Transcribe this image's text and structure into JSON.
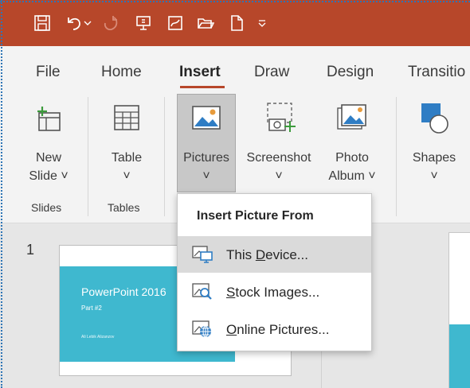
{
  "quick_access": {
    "icons": [
      "save-icon",
      "undo-icon",
      "undo-dropdown-icon",
      "redo-icon",
      "presenter-icon",
      "ink-icon",
      "open-folder-icon",
      "new-file-icon",
      "customize-qat-icon"
    ]
  },
  "tabs": [
    {
      "label": "File"
    },
    {
      "label": "Home"
    },
    {
      "label": "Insert"
    },
    {
      "label": "Draw"
    },
    {
      "label": "Design"
    },
    {
      "label": "Transitio"
    }
  ],
  "active_tab": "Insert",
  "ribbon": {
    "new_slide": {
      "line1": "New",
      "line2": "Slide ˅"
    },
    "table": {
      "line1": "Table",
      "line2": "˅"
    },
    "pictures": {
      "line1": "Pictures",
      "line2": "˅"
    },
    "screenshot": {
      "line1": "Screenshot",
      "line2": "˅"
    },
    "photo_album": {
      "line1": "Photo",
      "line2": "Album ˅"
    },
    "shapes": {
      "line1": "Shapes",
      "line2": "˅"
    },
    "groups": {
      "slides": "Slides",
      "tables": "Tables"
    }
  },
  "dropdown": {
    "header": "Insert Picture From",
    "items": [
      {
        "pre": "This ",
        "ul": "D",
        "post": "evice...",
        "icon": "device-picture-icon"
      },
      {
        "pre": "",
        "ul": "S",
        "post": "tock Images...",
        "icon": "stock-images-icon"
      },
      {
        "pre": "",
        "ul": "O",
        "post": "nline Pictures...",
        "icon": "online-pictures-icon"
      }
    ]
  },
  "slides_pane": {
    "slide_number": "1",
    "thumb_title": "PowerPoint 2016",
    "thumb_subtitle": "Part #2",
    "thumb_author": "Ali Lebik Alizanzov"
  },
  "colors": {
    "titlebar": "#b7472a",
    "accent": "#b7472a",
    "slide_accent": "#3fb8cf",
    "ribbon_bg": "#f3f3f3",
    "pressed": "#c8c8c8"
  }
}
